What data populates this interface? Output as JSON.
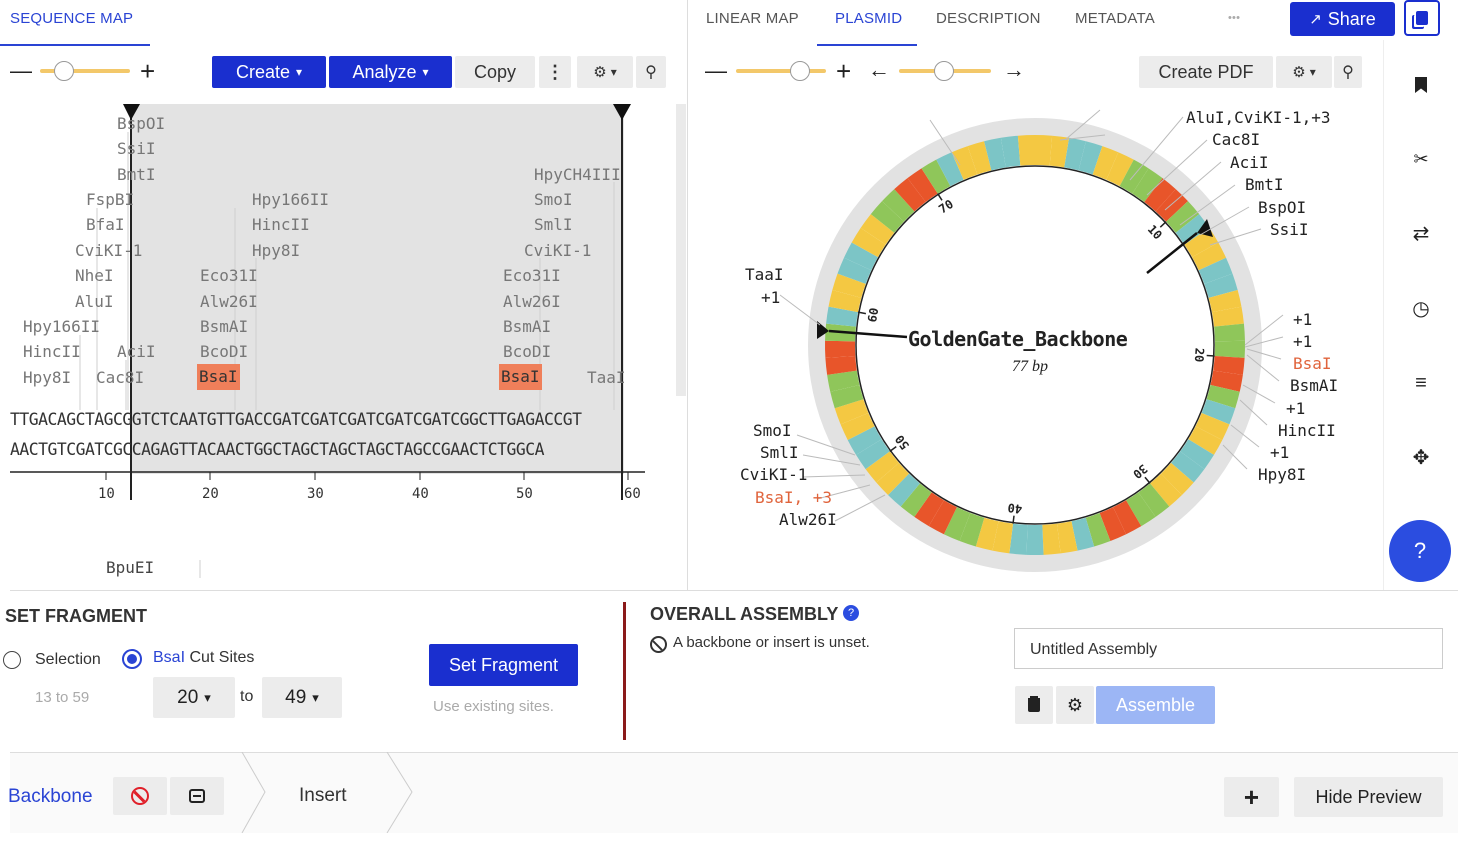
{
  "left_tabs": {
    "sequence_map": "SEQUENCE MAP"
  },
  "right_tabs": {
    "linear_map": "LINEAR MAP",
    "plasmid": "PLASMID",
    "description": "DESCRIPTION",
    "metadata": "METADATA",
    "more": "•••"
  },
  "header": {
    "share_label": "Share"
  },
  "left_toolbar": {
    "zoom_out": "—",
    "zoom_in": "+",
    "create": "Create",
    "analyze": "Analyze",
    "copy": "Copy",
    "more": "⋮"
  },
  "right_toolbar": {
    "zoom_out": "—",
    "zoom_in": "+",
    "rot_left": "←",
    "rot_right": "→",
    "create_pdf": "Create PDF"
  },
  "sequence_view": {
    "enzymes": [
      "BspOI",
      "SsiI",
      "BmtI",
      "FspBI",
      "BfaI",
      "CviKI-1",
      "NheI",
      "AluI",
      "Hpy166II",
      "HincII",
      "Hpy8I",
      "AciI",
      "Cac8I",
      "Hpy166II",
      "HincII",
      "Hpy8I",
      "Eco31I",
      "Alw26I",
      "BsmAI",
      "BcoDI",
      "BsaI",
      "HpyCH4III",
      "SmoI",
      "SmlI",
      "CviKI-1",
      "Eco31I",
      "Alw26I",
      "BsmAI",
      "BcoDI",
      "BsaI",
      "TaaI",
      "BpuEI"
    ],
    "top_strand": "TTGACAGCTAGCGGTCTCAATGTTGACCGATCGATCGATCGATCGATCGGCTTGAGACCGT",
    "bottom_strand": "AACTGTCGATCGCCAGAGTTACAACTGGCTAGCTAGCTAGCTAGCCGAACTCTGGCA",
    "ticks": [
      "10",
      "20",
      "30",
      "40",
      "50",
      "60"
    ]
  },
  "plasmid": {
    "name": "GoldenGate_Backbone",
    "length": "77 bp",
    "ring_ticks": [
      "10",
      "20",
      "30",
      "40",
      "50",
      "60",
      "70"
    ],
    "labels_right_top": [
      "AluI,CviKI-1,+3",
      "Cac8I",
      "AciI",
      "BmtI",
      "BspOI",
      "SsiI"
    ],
    "labels_left_top": [
      "TaaI",
      "+1"
    ],
    "labels_right_mid": [
      "+1",
      "+1",
      "BsaI",
      "BsmAI",
      "+1",
      "HincII",
      "+1",
      "Hpy8I"
    ],
    "labels_left_bottom": [
      "SmoI",
      "SmlI",
      "CviKI-1",
      "BsaI, +3",
      "Alw26I"
    ]
  },
  "set_fragment": {
    "title": "SET FRAGMENT",
    "selection": "Selection",
    "bsai": "BsaI",
    "cut_sites": " Cut Sites",
    "range_hint": "13 to 59",
    "from": "20",
    "to_label": "to",
    "to": "49",
    "button": "Set Fragment",
    "hint": "Use existing sites."
  },
  "overall_assembly": {
    "title": "OVERALL ASSEMBLY",
    "warning": "A backbone or insert is unset.",
    "name_value": "Untitled Assembly",
    "assemble": "Assemble"
  },
  "bottom_bar": {
    "backbone": "Backbone",
    "insert": "Insert",
    "hide_preview": "Hide Preview"
  },
  "help": "?",
  "colors": {
    "accent": "#1a2fcf",
    "highlight": "#ef7f5a",
    "divider": "#8b1a1a"
  }
}
